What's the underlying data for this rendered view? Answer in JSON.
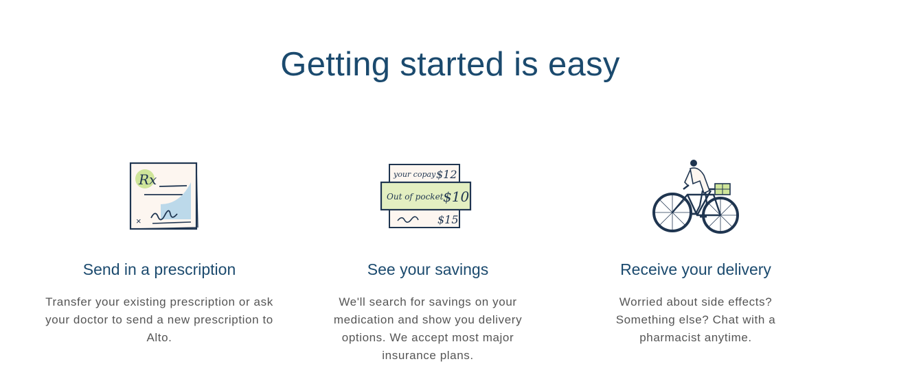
{
  "section": {
    "heading": "Getting started is easy"
  },
  "steps": [
    {
      "icon": "prescription-icon",
      "title": "Send in a prescription",
      "description": "Transfer your existing prescription or ask your doctor to send a new prescription to Alto.",
      "illustration_text": {
        "rx": "Rx",
        "x_mark": "×"
      }
    },
    {
      "icon": "savings-icon",
      "title": "See your savings",
      "description": "We'll search for savings on your medication and show you delivery options. We accept most major insurance plans.",
      "illustration_text": {
        "copay_label": "your copay",
        "copay_value": "$12",
        "oop_label": "Out of pocket",
        "oop_value": "$10",
        "third_value": "$15"
      }
    },
    {
      "icon": "bicycle-delivery-icon",
      "title": "Receive your delivery",
      "description": "Worried about side effects? Something else? Chat with a pharmacist anytime."
    }
  ],
  "colors": {
    "heading": "#1b4a6e",
    "body_text": "#555555",
    "ink": "#1f3550",
    "accent_green": "#cfe59a",
    "accent_blue": "#bcd9ea",
    "paper": "#fdf6f0"
  }
}
